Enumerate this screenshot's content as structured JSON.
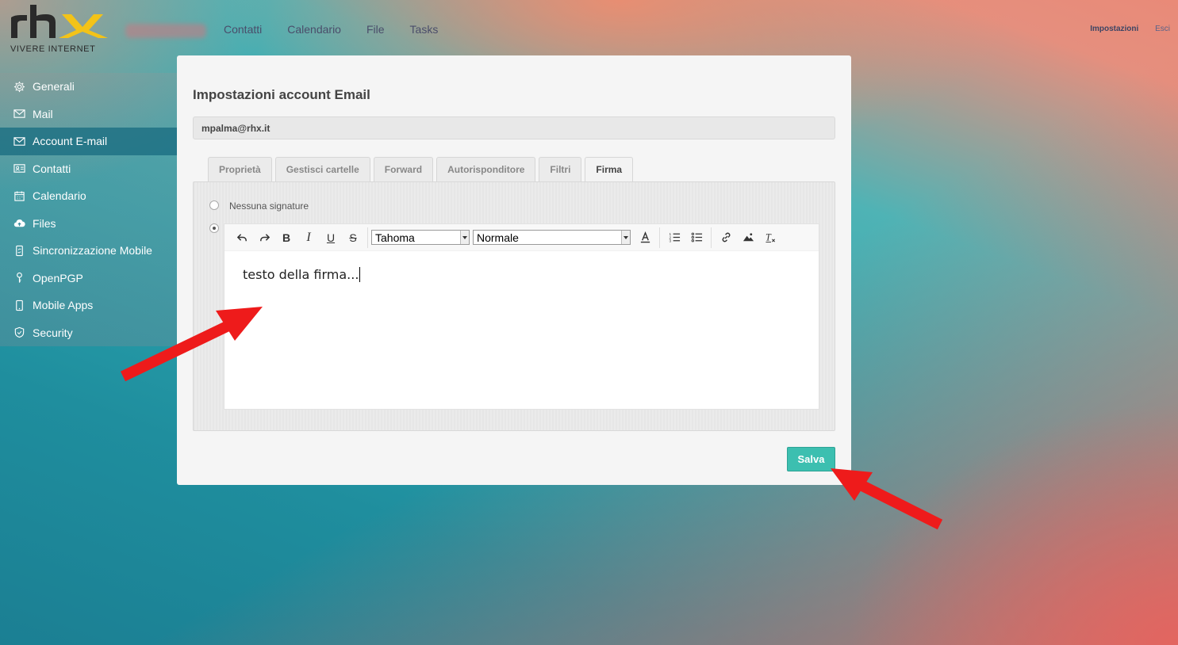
{
  "brand": {
    "tagline": "VIVERE INTERNET",
    "logo_alt": "rhx"
  },
  "topnav": {
    "items": [
      {
        "label": "Contatti"
      },
      {
        "label": "Calendario"
      },
      {
        "label": "File"
      },
      {
        "label": "Tasks"
      }
    ],
    "settings_label": "Impostazioni",
    "logout_label": "Esci"
  },
  "sidebar": {
    "items": [
      {
        "label": "Generali",
        "icon": "gear-icon"
      },
      {
        "label": "Mail",
        "icon": "envelope-icon"
      },
      {
        "label": "Account E-mail",
        "icon": "envelope-icon",
        "active": true
      },
      {
        "label": "Contatti",
        "icon": "contact-card-icon"
      },
      {
        "label": "Calendario",
        "icon": "calendar-icon"
      },
      {
        "label": "Files",
        "icon": "cloud-upload-icon"
      },
      {
        "label": "Sincronizzazione Mobile",
        "icon": "mobile-sync-icon"
      },
      {
        "label": "OpenPGP",
        "icon": "key-icon"
      },
      {
        "label": "Mobile Apps",
        "icon": "phone-icon"
      },
      {
        "label": "Security",
        "icon": "shield-icon"
      }
    ]
  },
  "main": {
    "title": "Impostazioni account Email",
    "email": "mpalma@rhx.it",
    "tabs": [
      {
        "label": "Proprietà"
      },
      {
        "label": "Gestisci cartelle"
      },
      {
        "label": "Forward"
      },
      {
        "label": "Autorisponditore"
      },
      {
        "label": "Filtri"
      },
      {
        "label": "Firma",
        "active": true
      }
    ],
    "signature": {
      "no_signature_label": "Nessuna signature",
      "selected_option": "custom",
      "font_family_value": "Tahoma",
      "font_size_value": "Normale",
      "content": "testo della firma..."
    },
    "save_label": "Salva"
  },
  "colors": {
    "accent": "#3cbfb0",
    "sidebar_active": "#1c6e82",
    "annotation_arrow": "#ee1b1b"
  }
}
